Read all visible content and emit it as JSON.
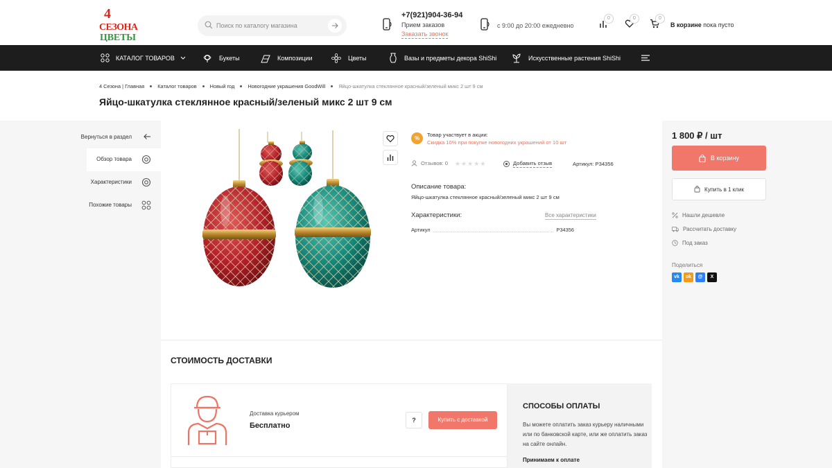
{
  "logo": {
    "top": "4",
    "line2": "СЕЗОНА",
    "line3": "ЦВЕТЫ"
  },
  "search": {
    "placeholder": "Поиск по каталогу магазина"
  },
  "contacts": {
    "phone": "+7(921)904-36-94",
    "phone_sub": "Прием заказов",
    "callback": "Заказать звонок",
    "hours": "с 9:00 до 20:00 ежедневно"
  },
  "header_icons": {
    "compare_count": "0",
    "favorites_count": "0",
    "cart_count": "0",
    "cart_bold": "В корзине",
    "cart_rest": "пока пусто"
  },
  "nav": {
    "catalog": "КАТАЛОГ ТОВАРОВ",
    "items": [
      "Букеты",
      "Композиции",
      "Цветы",
      "Вазы и предметы декора ShiShi",
      "Искусственные растения ShiShi"
    ]
  },
  "breadcrumb": [
    "4 Сезона | Главная",
    "Каталог товаров",
    "Новый год",
    "Новогодние украшения GoodWill",
    "Яйцо-шкатулка стеклянное красный/зеленый микс 2 шт 9 см"
  ],
  "page_title": "Яйцо-шкатулка стеклянное красный/зеленый микс 2 шт 9 см",
  "side": {
    "back": "Вернуться в раздел",
    "tabs": [
      "Обзор товара",
      "Характеристики",
      "Похожие товары"
    ]
  },
  "promo": {
    "icon": "%",
    "line1": "Товар участвует в акции:",
    "line2": "Скидка 10% при покупке новогодних украшений от 10 шт"
  },
  "reviews": {
    "label": "Отзывов: 0",
    "rating": 0,
    "add": "Добавить отзыв",
    "sku": "Артикул: P34356"
  },
  "description": {
    "heading": "Описание товара:",
    "text": "Яйцо-шкатулка стеклянное красный/зеленый микс 2 шт 9 см"
  },
  "characteristics": {
    "heading": "Характеристики:",
    "all_link": "Все характеристики",
    "rows": [
      {
        "key": "Артикул",
        "value": "P34356"
      }
    ]
  },
  "buy": {
    "price": "1 800 ₽ / шт",
    "add_to_cart": "В корзину",
    "one_click": "Купить в 1 клик",
    "links": [
      "Нашли дешевле",
      "Рассчитать доставку",
      "Под заказ"
    ],
    "share": "Поделиться",
    "share_icons": [
      "vk-icon",
      "ok-icon",
      "mail-icon",
      "x-icon"
    ]
  },
  "delivery": {
    "heading": "СТОИМОСТЬ ДОСТАВКИ",
    "method": "Доставка курьером",
    "price": "Бесплатно",
    "question": "?",
    "buy_button": "Купить с доставкой"
  },
  "payment": {
    "heading": "СПОСОБЫ ОПЛАТЫ",
    "text": "Вы можете оплатить заказ курьеру наличными или по банковской карте, или же оплатить заказ на сайте онлайн.",
    "accepted": "Принимаем к оплате"
  },
  "colors": {
    "accent": "#f0776a",
    "nav_bg": "#1d1d1d",
    "promo": "#f5a22b",
    "logo_red": "#d9261c",
    "logo_green": "#2c9a38"
  }
}
